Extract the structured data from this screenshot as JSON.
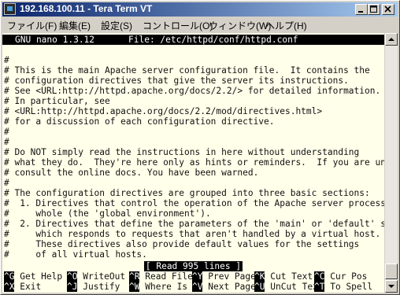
{
  "window": {
    "title": "192.168.100.11 - Tera Term VT"
  },
  "menu": [
    "ファイル(F)",
    "編集(E)",
    "設定(S)",
    "コントロール(O)",
    "ウィンドウ(W)",
    "ヘルプ(H)"
  ],
  "nano": {
    "version": "GNU nano 1.3.12",
    "file": "File: /etc/httpd/conf/httpd.conf",
    "lines": [
      "#",
      "# This is the main Apache server configuration file.  It contains the",
      "# configuration directives that give the server its instructions.",
      "# See <URL:http://httpd.apache.org/docs/2.2/> for detailed information.",
      "# In particular, see",
      "# <URL:http://httpd.apache.org/docs/2.2/mod/directives.html>",
      "# for a discussion of each configuration directive.",
      "#",
      "#",
      "# Do NOT simply read the instructions in here without understanding",
      "# what they do.  They're here only as hints or reminders.  If you are unsure",
      "# consult the online docs. You have been warned.",
      "#",
      "# The configuration directives are grouped into three basic sections:",
      "#  1. Directives that control the operation of the Apache server process as a",
      "#     whole (the 'global environment').",
      "#  2. Directives that define the parameters of the 'main' or 'default' server,",
      "#     which responds to requests that aren't handled by a virtual host.",
      "#     These directives also provide default values for the settings",
      "#     of all virtual hosts."
    ],
    "status": "[ Read 995 lines ]",
    "shortcuts_row1": [
      {
        "key": "^G",
        "label": "Get Help"
      },
      {
        "key": "^O",
        "label": "WriteOut"
      },
      {
        "key": "^R",
        "label": "Read File"
      },
      {
        "key": "^Y",
        "label": "Prev Page"
      },
      {
        "key": "^K",
        "label": "Cut Text"
      },
      {
        "key": "^C",
        "label": "Cur Pos"
      }
    ],
    "shortcuts_row2": [
      {
        "key": "^X",
        "label": "Exit"
      },
      {
        "key": "^J",
        "label": "Justify"
      },
      {
        "key": "^W",
        "label": "Where Is"
      },
      {
        "key": "^V",
        "label": "Next Page"
      },
      {
        "key": "^U",
        "label": "UnCut Text"
      },
      {
        "key": "^T",
        "label": "To Spell"
      }
    ]
  },
  "colors": {
    "terminal_bg": "#ffffea",
    "titlebar_start": "#0a246a",
    "titlebar_end": "#a6caf0",
    "chrome": "#d4d0c8"
  }
}
